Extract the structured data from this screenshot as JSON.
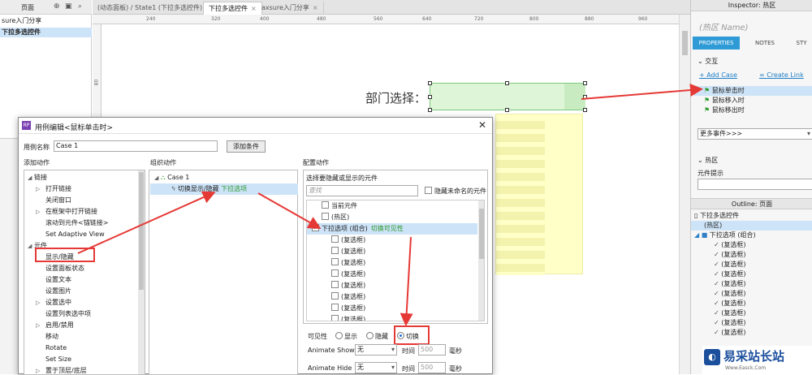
{
  "pages": {
    "header": "页面",
    "items": [
      {
        "label": "sure入门分享",
        "selected": false
      },
      {
        "label": "下拉多选控件",
        "selected": true
      }
    ]
  },
  "tabs": [
    {
      "label": "(动态面板) / State1 (下拉多选控件)",
      "active": false
    },
    {
      "label": "下拉多选控件",
      "active": true
    },
    {
      "label": "axsure入门分享",
      "active": false
    }
  ],
  "ruler": {
    "h_ticks": [
      "240",
      "320",
      "400",
      "480",
      "560",
      "640",
      "720",
      "800",
      "880",
      "960"
    ],
    "v_ticks": [
      "80"
    ]
  },
  "canvas": {
    "label": "部门选择："
  },
  "inspector": {
    "title": "Inspector: 热区",
    "name_placeholder": "(热区 Name)",
    "tabs": [
      "PROPERTIES",
      "NOTES",
      "STY"
    ],
    "interaction_header": "交互",
    "add_case": "Add Case",
    "create_link": "Create Link",
    "events": [
      "鼠标单击时",
      "鼠标移入时",
      "鼠标移出时"
    ],
    "more_events": "更多事件>>>",
    "hotspot_header": "热区",
    "tooltip_label": "元件提示"
  },
  "outline": {
    "title": "Outline: 页面",
    "items": [
      "下拉多选控件",
      "(热区)",
      "下拉选项 (组合)",
      "(复选框)",
      "(复选框)",
      "(复选框)",
      "(复选框)",
      "(复选框)",
      "(复选框)",
      "(复选框)",
      "(复选框)",
      "(复选框)",
      "(复选框)"
    ]
  },
  "watermark": {
    "text": "易采站长站",
    "sub": "Www.Easck.Com"
  },
  "dialog": {
    "title": "用例编辑<鼠标单击时>",
    "case_name_label": "用例名称",
    "case_name_value": "Case 1",
    "add_condition": "添加条件",
    "col_add": "添加动作",
    "col_organize": "组织动作",
    "col_config": "配置动作",
    "actions_tree": [
      {
        "label": "链接",
        "level": 0,
        "toggle": "◢"
      },
      {
        "label": "打开链接",
        "level": 1,
        "toggle": "▷"
      },
      {
        "label": "关闭窗口",
        "level": 1,
        "toggle": ""
      },
      {
        "label": "在框架中打开链接",
        "level": 1,
        "toggle": "▷"
      },
      {
        "label": "滚动到元件<锚链接>",
        "level": 1,
        "toggle": ""
      },
      {
        "label": "Set Adaptive View",
        "level": 1,
        "toggle": ""
      },
      {
        "label": "元件",
        "level": 0,
        "toggle": "◢"
      },
      {
        "label": "显示/隐藏",
        "level": 1,
        "toggle": ""
      },
      {
        "label": "设置面板状态",
        "level": 1,
        "toggle": ""
      },
      {
        "label": "设置文本",
        "level": 1,
        "toggle": ""
      },
      {
        "label": "设置图片",
        "level": 1,
        "toggle": ""
      },
      {
        "label": "设置选中",
        "level": 1,
        "toggle": "▷"
      },
      {
        "label": "设置列表选中项",
        "level": 1,
        "toggle": ""
      },
      {
        "label": "启用/禁用",
        "level": 1,
        "toggle": "▷"
      },
      {
        "label": "移动",
        "level": 1,
        "toggle": ""
      },
      {
        "label": "Rotate",
        "level": 1,
        "toggle": ""
      },
      {
        "label": "Set Size",
        "level": 1,
        "toggle": ""
      },
      {
        "label": "置于顶层/底层",
        "level": 1,
        "toggle": "▷"
      }
    ],
    "organize": {
      "case": "Case 1",
      "action": "切换显示/隐藏",
      "action_target": "下拉选项"
    },
    "config": {
      "select_label": "选择要隐藏或显示的元件",
      "search_placeholder": "查找",
      "hide_unnamed": "隐藏未命名的元件",
      "widgets": [
        {
          "label": "当前元件",
          "checked": false,
          "indent": 1,
          "note": ""
        },
        {
          "label": "(热区)",
          "checked": false,
          "indent": 1,
          "note": ""
        },
        {
          "label": "下拉选项 (组合)",
          "checked": true,
          "indent": 0,
          "note": "切换可见性"
        },
        {
          "label": "(复选框)",
          "checked": false,
          "indent": 2,
          "note": ""
        },
        {
          "label": "(复选框)",
          "checked": false,
          "indent": 2,
          "note": ""
        },
        {
          "label": "(复选框)",
          "checked": false,
          "indent": 2,
          "note": ""
        },
        {
          "label": "(复选框)",
          "checked": false,
          "indent": 2,
          "note": ""
        },
        {
          "label": "(复选框)",
          "checked": false,
          "indent": 2,
          "note": ""
        },
        {
          "label": "(复选框)",
          "checked": false,
          "indent": 2,
          "note": ""
        },
        {
          "label": "(复选框)",
          "checked": false,
          "indent": 2,
          "note": ""
        },
        {
          "label": "(复选框)",
          "checked": false,
          "indent": 2,
          "note": ""
        },
        {
          "label": "(复选框)",
          "checked": false,
          "indent": 2,
          "note": ""
        }
      ],
      "visibility_label": "可见性",
      "radio_show": "显示",
      "radio_hide": "隐藏",
      "radio_toggle": "切换",
      "anim_show_label": "Animate Show",
      "anim_hide_label": "Animate Hide",
      "anim_value": "无",
      "time_label": "时间",
      "time_value": "500",
      "ms_label": "毫秒"
    }
  },
  "colors": {
    "accent": "#2f9bd6",
    "arrow": "#e53935",
    "hotspot": "#dff5d8",
    "dropdown": "#ffffc8"
  }
}
